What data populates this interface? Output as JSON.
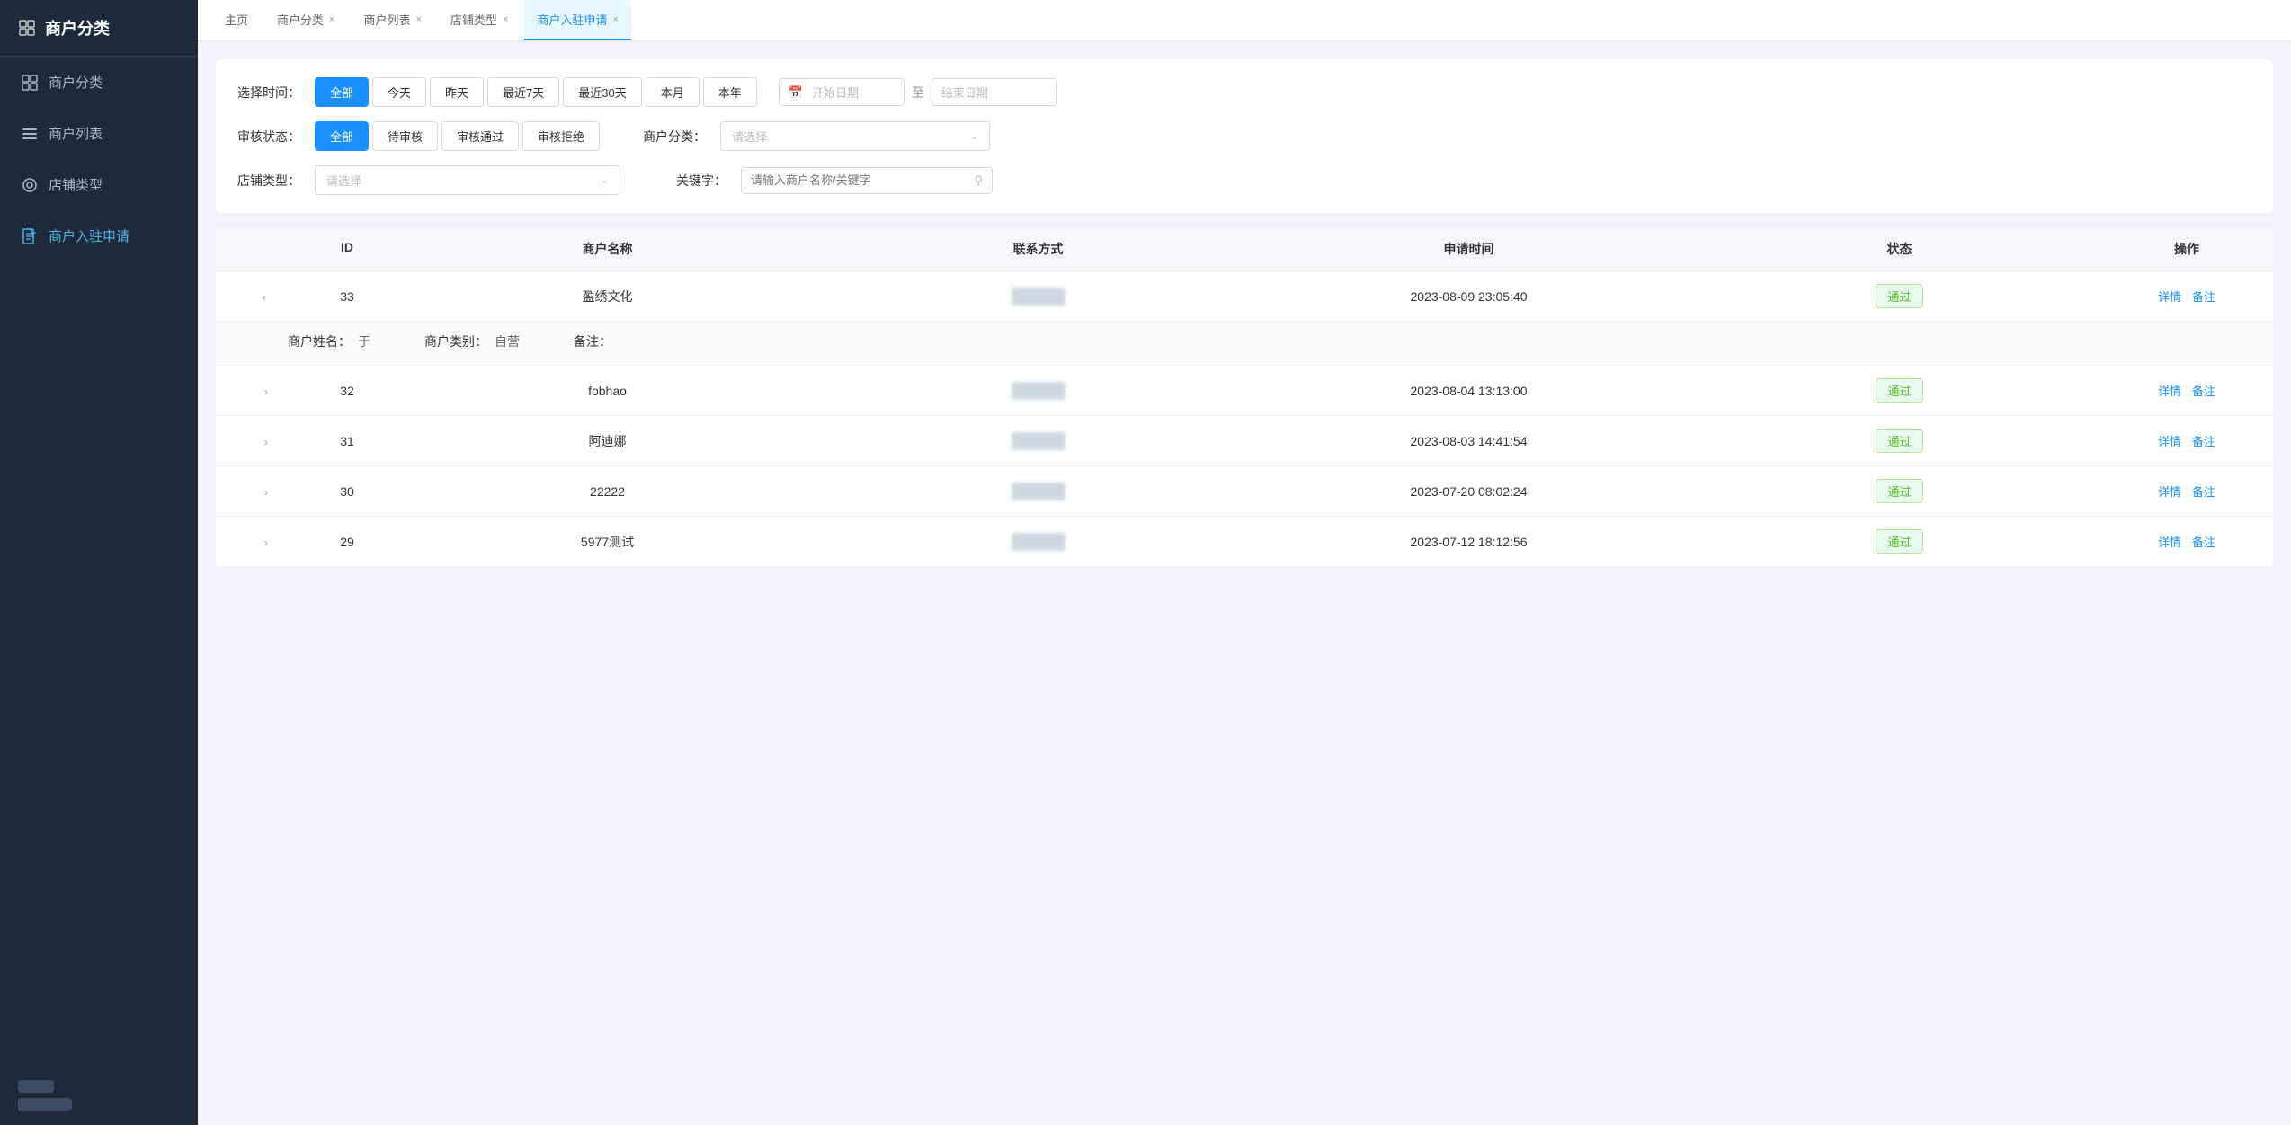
{
  "sidebar": {
    "title": "商户分类",
    "items": [
      {
        "id": "merchant-category",
        "label": "商户分类",
        "icon": "grid-icon",
        "active": false
      },
      {
        "id": "merchant-list",
        "label": "商户列表",
        "icon": "list-icon",
        "active": false
      },
      {
        "id": "store-type",
        "label": "店铺类型",
        "icon": "circle-icon",
        "active": false
      },
      {
        "id": "merchant-apply",
        "label": "商户入驻申请",
        "icon": "file-icon",
        "active": true
      }
    ]
  },
  "tabs": [
    {
      "id": "home",
      "label": "主页",
      "closable": false
    },
    {
      "id": "merchant-category",
      "label": "商户分类",
      "closable": true
    },
    {
      "id": "merchant-list",
      "label": "商户列表",
      "closable": true
    },
    {
      "id": "store-type",
      "label": "店铺类型",
      "closable": true
    },
    {
      "id": "merchant-apply",
      "label": "商户入驻申请",
      "closable": true,
      "active": true
    }
  ],
  "filters": {
    "time_label": "选择时间：",
    "time_buttons": [
      "全部",
      "今天",
      "昨天",
      "最近7天",
      "最近30天",
      "本月",
      "本年"
    ],
    "time_active": "全部",
    "date_start_placeholder": "开始日期",
    "date_end_placeholder": "结束日期",
    "date_sep": "至",
    "status_label": "审核状态：",
    "status_buttons": [
      "全部",
      "待审核",
      "审核通过",
      "审核拒绝"
    ],
    "status_active": "全部",
    "category_label": "商户分类：",
    "category_placeholder": "请选择",
    "store_type_label": "店铺类型：",
    "store_type_placeholder": "请选择",
    "keyword_label": "关键字：",
    "keyword_placeholder": "请输入商户名称/关键字"
  },
  "table": {
    "headers": [
      "",
      "ID",
      "商户名称",
      "联系方式",
      "申请时间",
      "状态",
      "操作"
    ],
    "rows": [
      {
        "id": 33,
        "name": "盈绣文化",
        "contact_blurred": true,
        "apply_time": "2023-08-09 23:05:40",
        "status": "通过",
        "expanded": true,
        "expand_data": {
          "merchant_name_label": "商户姓名：",
          "merchant_name_value": "于",
          "category_label": "商户类别：",
          "category_value": "自营",
          "remark_label": "备注："
        }
      },
      {
        "id": 32,
        "name": "fobhao",
        "contact_blurred": true,
        "apply_time": "2023-08-04 13:13:00",
        "status": "通过",
        "expanded": false
      },
      {
        "id": 31,
        "name": "阿迪娜",
        "contact_blurred": true,
        "apply_time": "2023-08-03 14:41:54",
        "status": "通过",
        "expanded": false
      },
      {
        "id": 30,
        "name": "22222",
        "contact_blurred": true,
        "apply_time": "2023-07-20 08:02:24",
        "status": "通过",
        "expanded": false
      },
      {
        "id": 29,
        "name": "5977测试",
        "contact_blurred": true,
        "apply_time": "2023-07-12 18:12:56",
        "status": "通过",
        "expanded": false
      }
    ],
    "actions": {
      "detail": "详情",
      "remark": "备注"
    }
  }
}
